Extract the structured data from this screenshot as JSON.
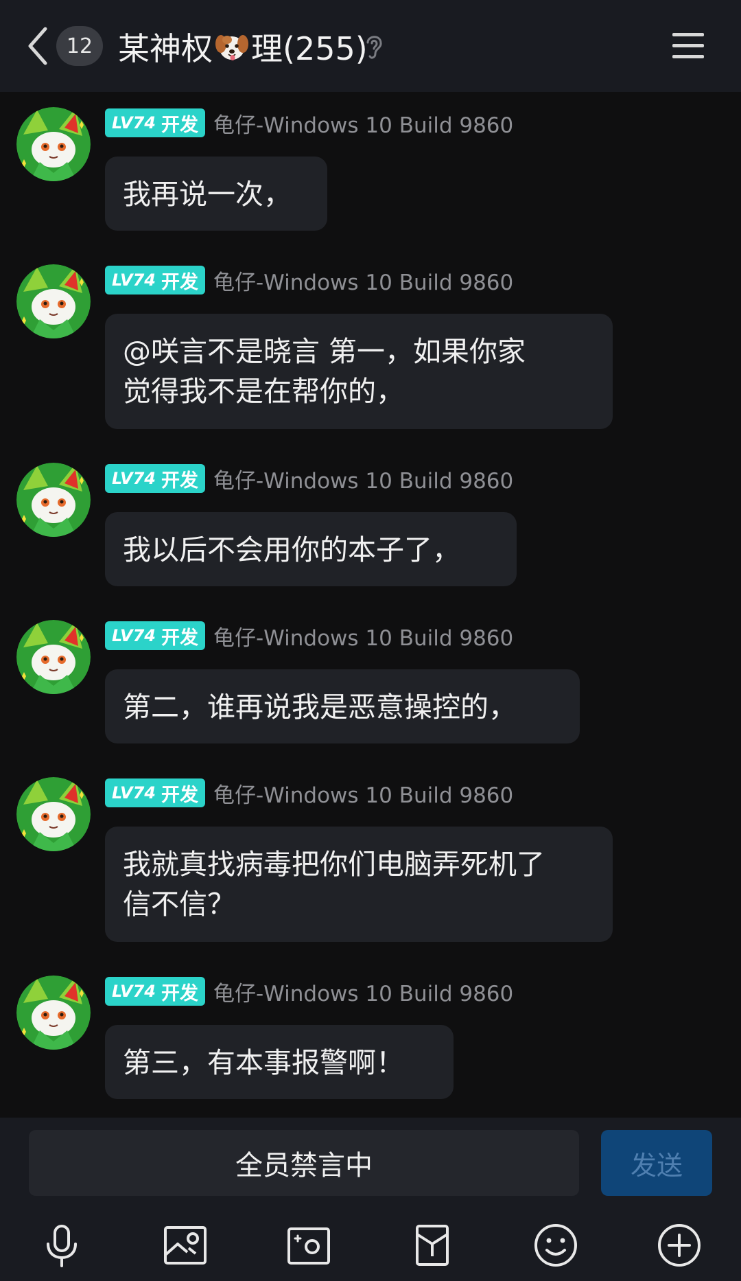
{
  "header": {
    "unread_count": "12",
    "title_prefix": "某神权",
    "title_suffix": "理(255)",
    "dog_emoji": "dog-face-emoji"
  },
  "colors": {
    "header_bg": "#191b21",
    "chat_bg": "#0f0f10",
    "bubble_bg": "#202227",
    "badge_teal": "#2bd3c9",
    "send_button_bg": "#0f4578"
  },
  "messages": [
    {
      "level": "LV74",
      "role": "开发",
      "sender": "龟仔-Windows 10 Build 9860",
      "lines": [
        "我再说一次，"
      ]
    },
    {
      "level": "LV74",
      "role": "开发",
      "sender": "龟仔-Windows 10 Build 9860",
      "lines": [
        "@咲言不是晓言 第一，如果你家",
        "觉得我不是在帮你的，"
      ]
    },
    {
      "level": "LV74",
      "role": "开发",
      "sender": "龟仔-Windows 10 Build 9860",
      "lines": [
        "我以后不会用你的本子了，"
      ]
    },
    {
      "level": "LV74",
      "role": "开发",
      "sender": "龟仔-Windows 10 Build 9860",
      "lines": [
        "第二，谁再说我是恶意操控的，"
      ]
    },
    {
      "level": "LV74",
      "role": "开发",
      "sender": "龟仔-Windows 10 Build 9860",
      "lines": [
        "我就真找病毒把你们电脑弄死机了",
        "信不信？"
      ]
    },
    {
      "level": "LV74",
      "role": "开发",
      "sender": "龟仔-Windows 10 Build 9860",
      "lines": [
        "第三，有本事报警啊！"
      ]
    }
  ],
  "input": {
    "muted_text": "全员禁言中",
    "send_label": "发送"
  },
  "toolbar": {
    "icons": [
      "microphone-icon",
      "image-icon",
      "camera-icon",
      "red-packet-icon",
      "emoji-icon",
      "plus-circle-icon"
    ]
  }
}
